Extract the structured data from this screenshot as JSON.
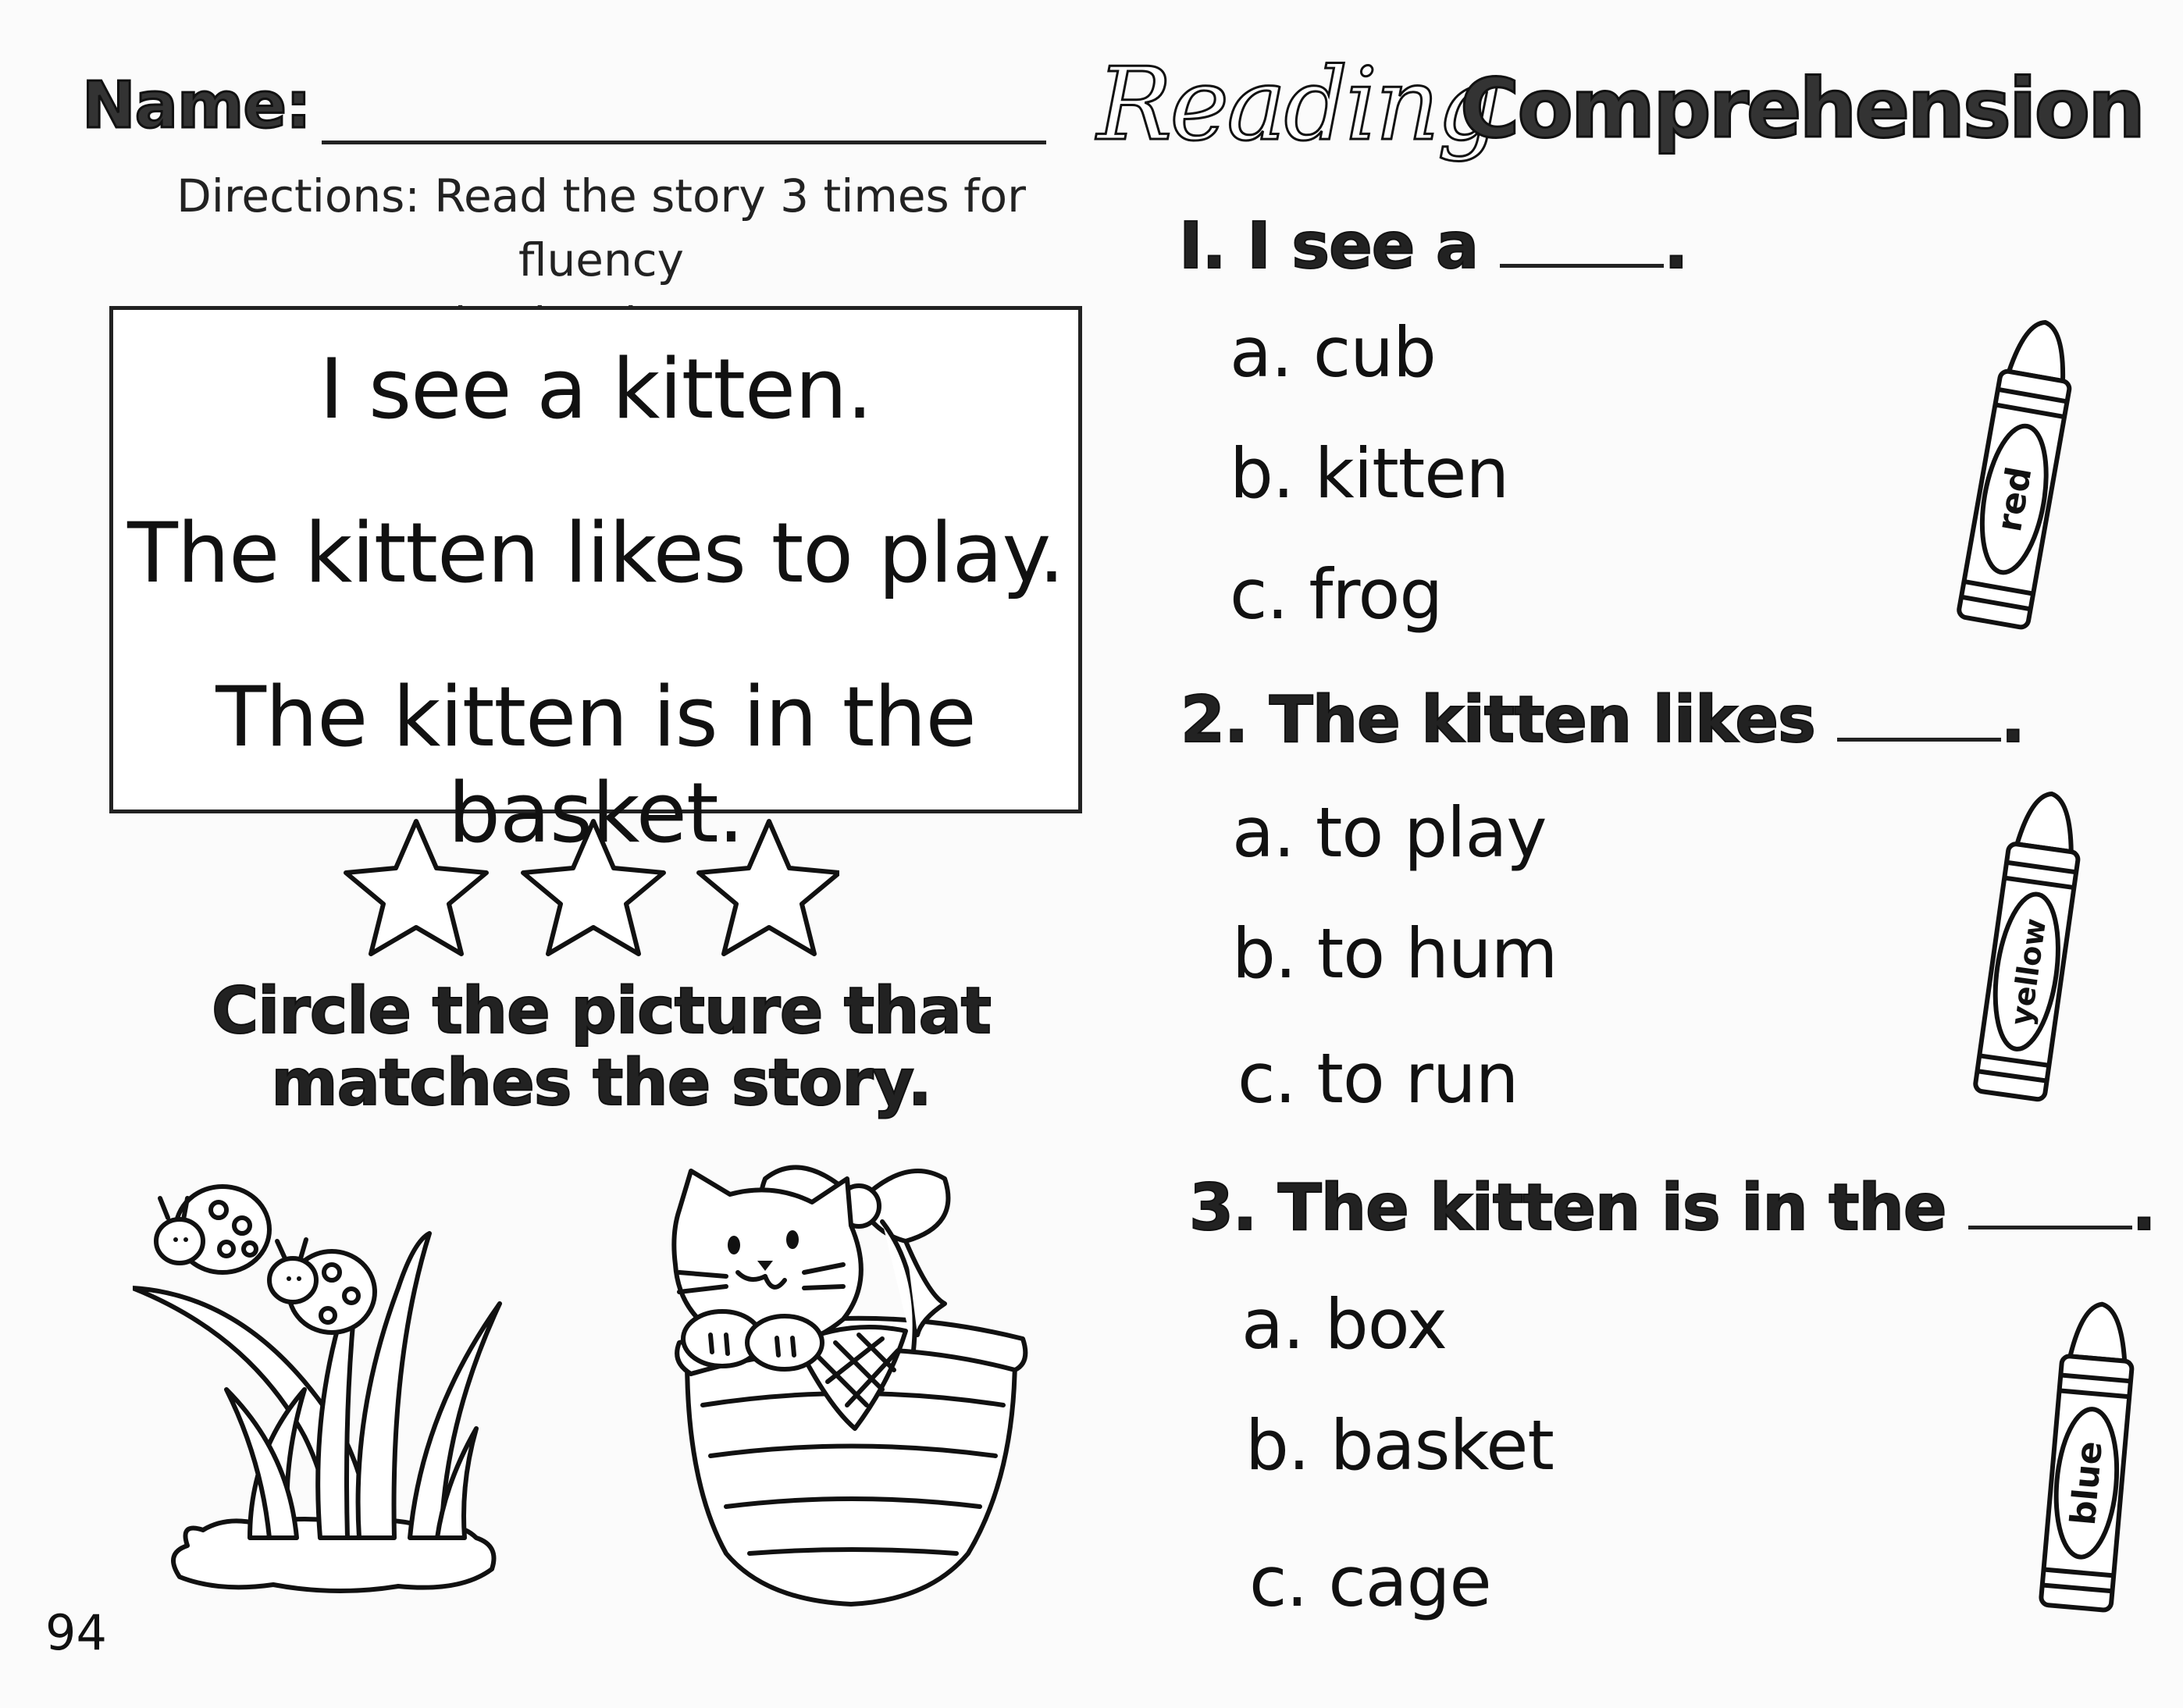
{
  "header": {
    "name_label": "Name:",
    "title_script": "Reading",
    "title_bold": "Comprehension"
  },
  "directions": {
    "line1": "Directions: Read the story 3 times for fluency",
    "line2": "and color the stars."
  },
  "story": {
    "lines": [
      "I see a kitten.",
      "The kitten likes to play.",
      "The kitten is in the basket."
    ]
  },
  "stars": {
    "count": 3
  },
  "circle_instruction": {
    "line1": "Circle the picture that",
    "line2": "matches the story."
  },
  "questions": [
    {
      "prompt": "I. I see a",
      "end": ".",
      "options": [
        "a. cub",
        "b. kitten",
        "c. frog"
      ],
      "crayon_label": "red"
    },
    {
      "prompt": "2. The kitten likes",
      "end": ".",
      "options": [
        "a. to play",
        "b. to hum",
        "c. to run"
      ],
      "crayon_label": "yellow"
    },
    {
      "prompt": "3. The kitten is in the",
      "end": ".",
      "options": [
        "a. box",
        "b. basket",
        "c. cage"
      ],
      "crayon_label": "blue"
    }
  ],
  "pictures": {
    "left": "ladybugs-on-grass-icon",
    "right": "kitten-in-basket-icon"
  },
  "page_number": "94"
}
